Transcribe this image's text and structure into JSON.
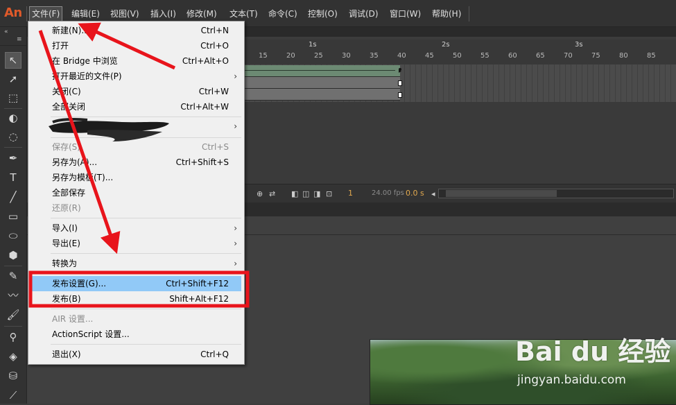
{
  "app": {
    "logo": "An"
  },
  "menubar": [
    {
      "id": "file",
      "label": "文件(F)",
      "active": true
    },
    {
      "id": "edit",
      "label": "编辑(E)"
    },
    {
      "id": "view",
      "label": "视图(V)"
    },
    {
      "id": "insert",
      "label": "插入(I)"
    },
    {
      "id": "modify",
      "label": "修改(M)"
    },
    {
      "id": "text",
      "label": "文本(T)"
    },
    {
      "id": "commands",
      "label": "命令(C)"
    },
    {
      "id": "control",
      "label": "控制(O)"
    },
    {
      "id": "debug",
      "label": "调试(D)"
    },
    {
      "id": "window",
      "label": "窗口(W)"
    },
    {
      "id": "help",
      "label": "帮助(H)"
    }
  ],
  "file_menu": {
    "items": [
      {
        "id": "new",
        "label": "新建(N)...",
        "shortcut": "Ctrl+N"
      },
      {
        "id": "open",
        "label": "打开",
        "shortcut": "Ctrl+O"
      },
      {
        "id": "browse-bridge",
        "label": "在 Bridge 中浏览",
        "shortcut": "Ctrl+Alt+O"
      },
      {
        "id": "open-recent",
        "label": "打开最近的文件(P)",
        "submenu": true
      },
      {
        "id": "close",
        "label": "关闭(C)",
        "shortcut": "Ctrl+W"
      },
      {
        "id": "close-all",
        "label": "全部关闭",
        "shortcut": "Ctrl+Alt+W"
      },
      {
        "id": "redacted",
        "label": "",
        "submenu": true,
        "redacted": true
      },
      {
        "id": "save",
        "label": "保存(S)",
        "shortcut": "Ctrl+S",
        "disabled": true
      },
      {
        "id": "save-as",
        "label": "另存为(A)...",
        "shortcut": "Ctrl+Shift+S"
      },
      {
        "id": "save-as-template",
        "label": "另存为模板(T)..."
      },
      {
        "id": "save-all",
        "label": "全部保存"
      },
      {
        "id": "revert",
        "label": "还原(R)",
        "disabled": true
      },
      {
        "id": "import",
        "label": "导入(I)",
        "submenu": true
      },
      {
        "id": "export",
        "label": "导出(E)",
        "submenu": true
      },
      {
        "id": "convert",
        "label": "转换为",
        "submenu": true
      },
      {
        "id": "publish-settings",
        "label": "发布设置(G)...",
        "shortcut": "Ctrl+Shift+F12",
        "highlighted": true
      },
      {
        "id": "publish",
        "label": "发布(B)",
        "shortcut": "Shift+Alt+F12"
      },
      {
        "id": "air-settings",
        "label": "AIR 设置...",
        "disabled": true
      },
      {
        "id": "actionscript-settings",
        "label": "ActionScript 设置..."
      },
      {
        "id": "exit",
        "label": "退出(X)",
        "shortcut": "Ctrl+Q"
      }
    ]
  },
  "timeline": {
    "seconds": [
      "1s",
      "2s",
      "3s"
    ],
    "frame_numbers": [
      "15",
      "20",
      "25",
      "30",
      "35",
      "40",
      "45",
      "50",
      "55",
      "60",
      "65",
      "70",
      "75",
      "80",
      "85"
    ],
    "current_frame": "1",
    "fps": "24.00 fps",
    "time": "0.0 s"
  },
  "watermark": {
    "brand": "Bai du 经验",
    "url": "jingyan.baidu.com"
  },
  "colors": {
    "annotation_red": "#e8141b",
    "menu_highlight": "#91c9f7",
    "logo": "#e05a2a"
  }
}
